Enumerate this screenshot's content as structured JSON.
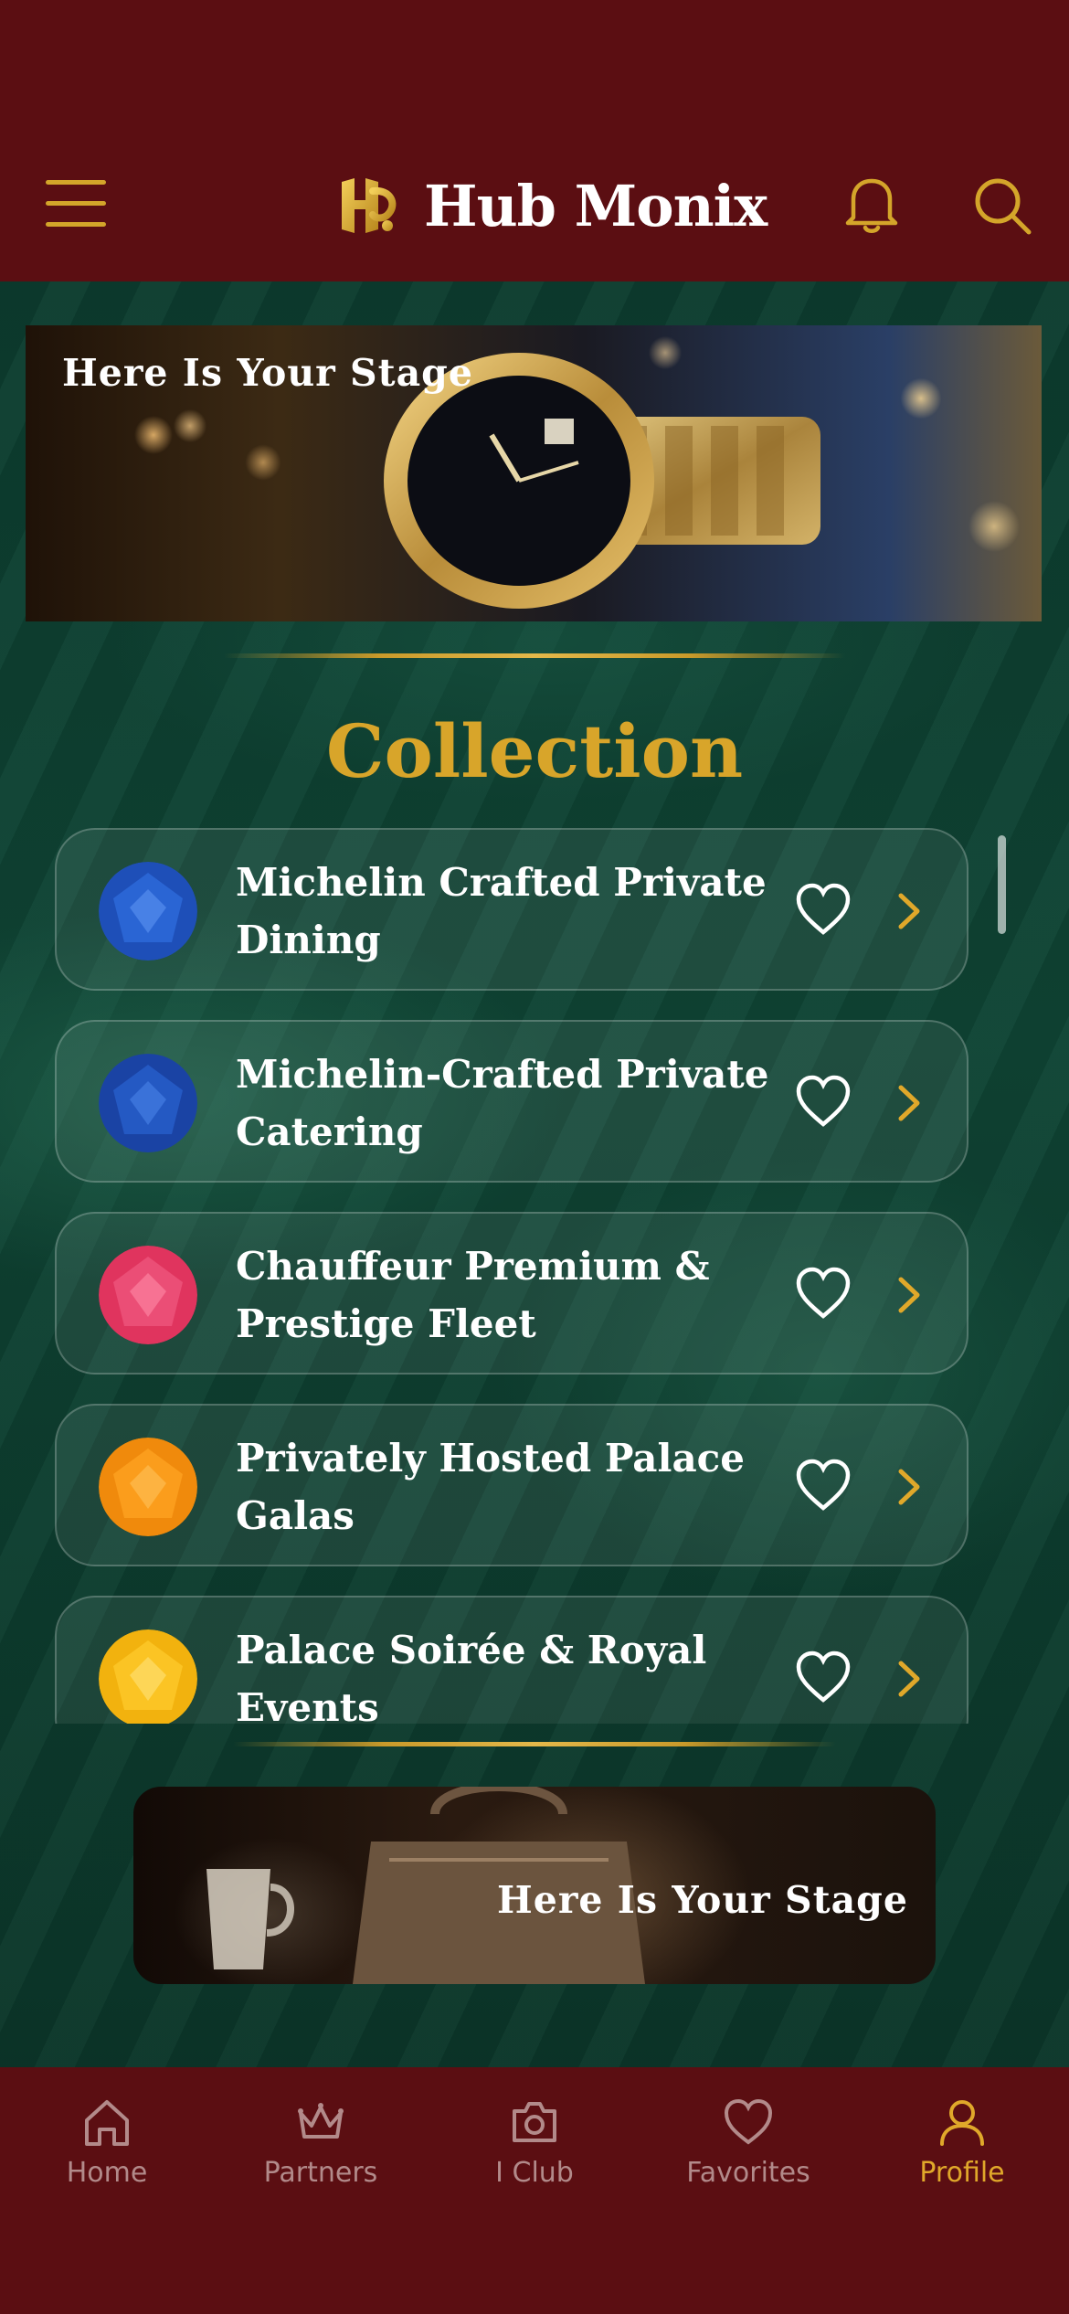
{
  "header": {
    "brand": "Hub Monix",
    "menu_icon": "hamburger-menu-icon",
    "notification_icon": "bell-icon",
    "search_icon": "search-icon",
    "accent": "#d4a52a",
    "background": "#5b0e12"
  },
  "hero": {
    "title": "Here Is Your Stage"
  },
  "collection": {
    "title": "Collection",
    "items": [
      {
        "label": "Michelin Crafted Private Dining",
        "gem": "blue-gem"
      },
      {
        "label": "Michelin-Crafted Private Catering",
        "gem": "blue-gem"
      },
      {
        "label": "Chauffeur Premium & Prestige Fleet",
        "gem": "pink-gem"
      },
      {
        "label": "Privately Hosted Palace Galas",
        "gem": "orange-gem"
      },
      {
        "label": "Palace Soirée & Royal Events",
        "gem": "yellow-gem"
      }
    ]
  },
  "promo": {
    "title": "Here Is Your Stage"
  },
  "tabbar": {
    "tabs": [
      {
        "label": "Home",
        "icon": "home-icon"
      },
      {
        "label": "Partners",
        "icon": "crown-icon"
      },
      {
        "label": "I Club",
        "icon": "camera-icon"
      },
      {
        "label": "Favorites",
        "icon": "heart-icon"
      },
      {
        "label": "Profile",
        "icon": "user-icon",
        "active": true
      }
    ]
  }
}
